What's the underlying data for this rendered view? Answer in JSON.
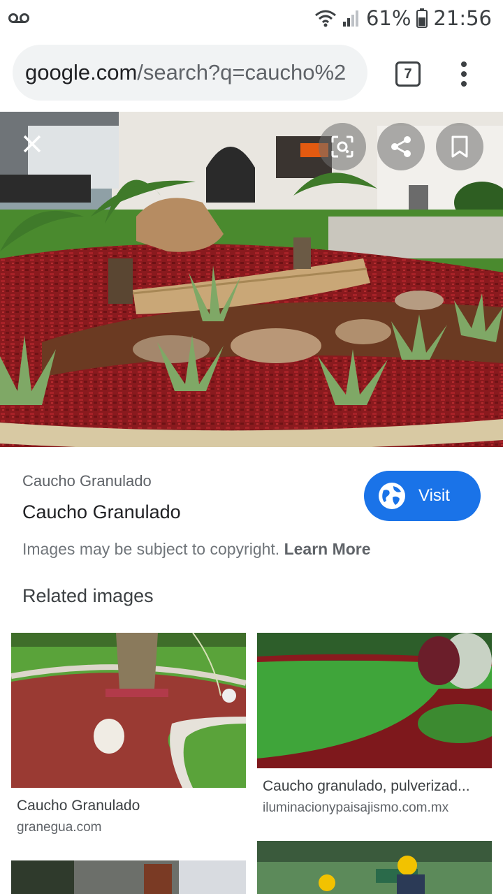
{
  "status_bar": {
    "battery": "61%",
    "time": "21:56",
    "icons": [
      "voicemail-icon",
      "wifi-icon",
      "signal-icon",
      "battery-icon"
    ]
  },
  "browser": {
    "url_host": "google.com",
    "url_path": "/search?q=caucho%2",
    "tab_count": "7"
  },
  "viewer": {
    "source": "Caucho Granulado",
    "title": "Caucho Granulado",
    "visit_label": "Visit",
    "copyright_text": "Images may be subject to copyright.",
    "learn_more": "Learn More",
    "related_heading": "Related images"
  },
  "related": [
    {
      "title": "Caucho Granulado",
      "source": "granegua.com"
    },
    {
      "title": "Caucho granulado, pulverizad...",
      "source": "iluminacionypaisajismo.com.mx"
    }
  ],
  "colors": {
    "accent": "#1a73e8",
    "mulch": "#8e1b1f",
    "grass": "#4a9a2a"
  }
}
